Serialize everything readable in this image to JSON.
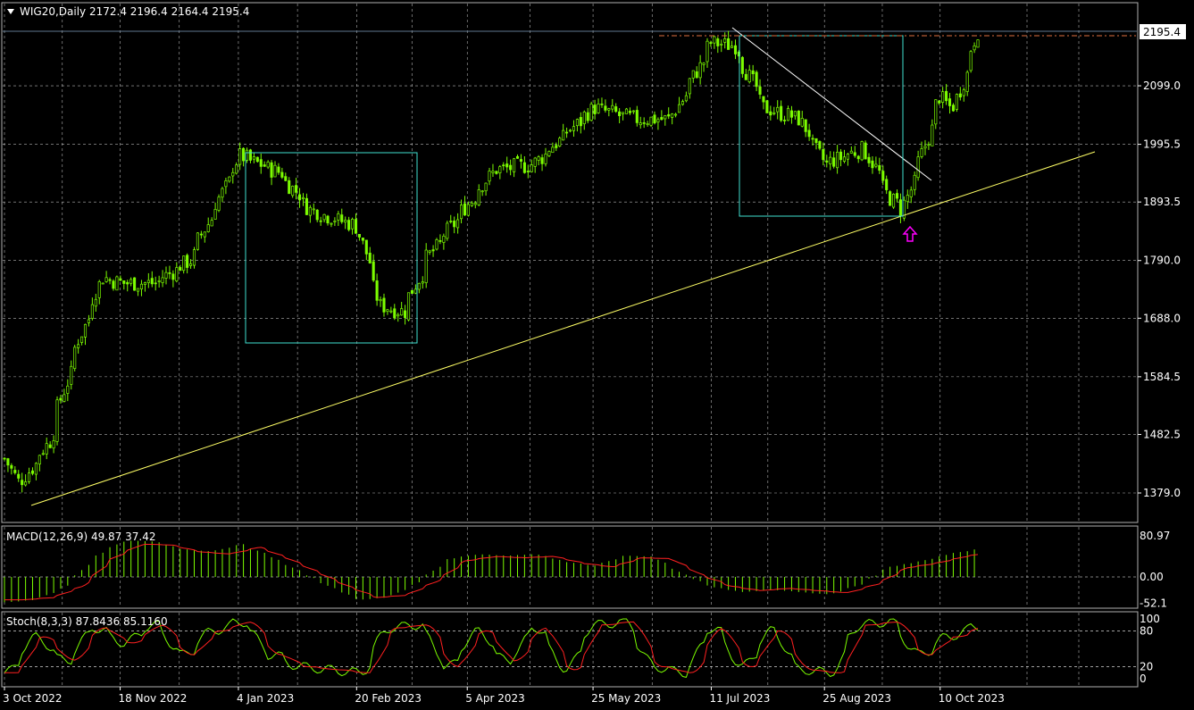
{
  "header": {
    "symbol_line": "WIG20,Daily  2172.4 2196.4 2164.4 2195.4"
  },
  "price_panel": {
    "current_price_label": "2195.4",
    "y_ticks": [
      "2099.0",
      "1995.5",
      "1893.5",
      "1790.0",
      "1688.0",
      "1584.5",
      "1482.5",
      "1379.0"
    ]
  },
  "macd_panel": {
    "title": "MACD(12,26,9) 49.87 37.42",
    "y_ticks": [
      "80.97",
      "0.00",
      "-52.1"
    ]
  },
  "stoch_panel": {
    "title": "Stoch(8,3,3) 87.8436 85.1160",
    "y_ticks": [
      "100",
      "80",
      "20",
      "0"
    ]
  },
  "x_axis": {
    "labels": [
      "3 Oct 2022",
      "18 Nov 2022",
      "4 Jan 2023",
      "20 Feb 2023",
      "5 Apr 2023",
      "25 May 2023",
      "11 Jul 2023",
      "25 Aug 2023",
      "10 Oct 2023"
    ]
  },
  "colors": {
    "background": "#000000",
    "candles": "#7cfc00",
    "grid": "#ffffff",
    "trendline_support": "#ffff66",
    "trendline_resistance": "#ffffff",
    "box": "#40e0d0",
    "arrow": "#ff00ff",
    "signal": "#ff2020",
    "price_line": "#e07040"
  },
  "chart_data": {
    "type": "candlestick",
    "series": [
      {
        "name": "WIG20",
        "x": [
          "3 Oct 2022",
          "8 Oct 2022",
          "20 Oct 2022",
          "1 Nov 2022",
          "10 Nov 2022",
          "18 Nov 2022",
          "1 Dec 2022",
          "15 Dec 2022",
          "4 Jan 2023",
          "20 Jan 2023",
          "1 Feb 2023",
          "20 Feb 2023",
          "1 Mar 2023",
          "10 Mar 2023",
          "20 Mar 2023",
          "5 Apr 2023",
          "15 Apr 2023",
          "1 May 2023",
          "25 May 2023",
          "10 Jun 2023",
          "25 Jun 2023",
          "11 Jul 2023",
          "20 Jul 2023",
          "1 Aug 2023",
          "15 Aug 2023",
          "25 Aug 2023",
          "10 Sep 2023",
          "20 Sep 2023",
          "25 Sep 2023",
          "1 Oct 2023",
          "10 Oct 2023",
          "15 Oct 2023",
          "20 Oct 2023",
          "25 Oct 2023"
        ],
        "close": [
          1440,
          1390,
          1470,
          1650,
          1760,
          1750,
          1750,
          1790,
          1975,
          1945,
          1880,
          1850,
          1710,
          1700,
          1795,
          1890,
          1950,
          1960,
          2060,
          2040,
          2040,
          2175,
          2170,
          2060,
          2040,
          1960,
          1990,
          1900,
          1880,
          1950,
          2080,
          2050,
          2120,
          2195
        ]
      },
      {
        "name": "MACD",
        "values": [
          -50,
          -45,
          -20,
          40,
          72,
          70,
          55,
          50,
          65,
          40,
          10,
          -20,
          -45,
          -40,
          -10,
          35,
          45,
          42,
          45,
          30,
          22,
          42,
          40,
          5,
          -20,
          -30,
          -25,
          -30,
          -35,
          -15,
          20,
          30,
          45,
          55
        ]
      },
      {
        "name": "Stoch",
        "values": [
          10,
          70,
          30,
          85,
          60,
          90,
          40,
          80,
          95,
          40,
          20,
          15,
          10,
          85,
          90,
          20,
          80,
          30,
          85,
          15,
          90,
          95,
          20,
          10,
          85,
          20,
          80,
          15,
          10,
          90,
          95,
          40,
          70,
          88
        ]
      }
    ],
    "ylim": [
      1330,
      2230
    ],
    "macd_ylim": [
      -75,
      95
    ],
    "stoch_ylim": [
      0,
      100
    ],
    "grid": true,
    "annotations": {
      "support_line": [
        {
          "x": "3 Oct 2022",
          "y": 1365
        },
        {
          "x": "25 Oct 2023",
          "y": 1990
        }
      ],
      "resistance_line": [
        {
          "x": "11 Jul 2023",
          "y": 2200
        },
        {
          "x": "1 Oct 2023",
          "y": 1920
        }
      ],
      "box_1": {
        "x_from": "4 Jan 2023",
        "x_to": "1 Mar 2023",
        "y_from": 1665,
        "y_to": 1990
      },
      "box_2": {
        "x_from": "11 Jul 2023",
        "x_to": "25 Sep 2023",
        "y_from": 1875,
        "y_to": 2195
      },
      "arrow_up_at": {
        "x": "25 Sep 2023",
        "y": 1855
      },
      "current_price": 2195.4
    }
  }
}
